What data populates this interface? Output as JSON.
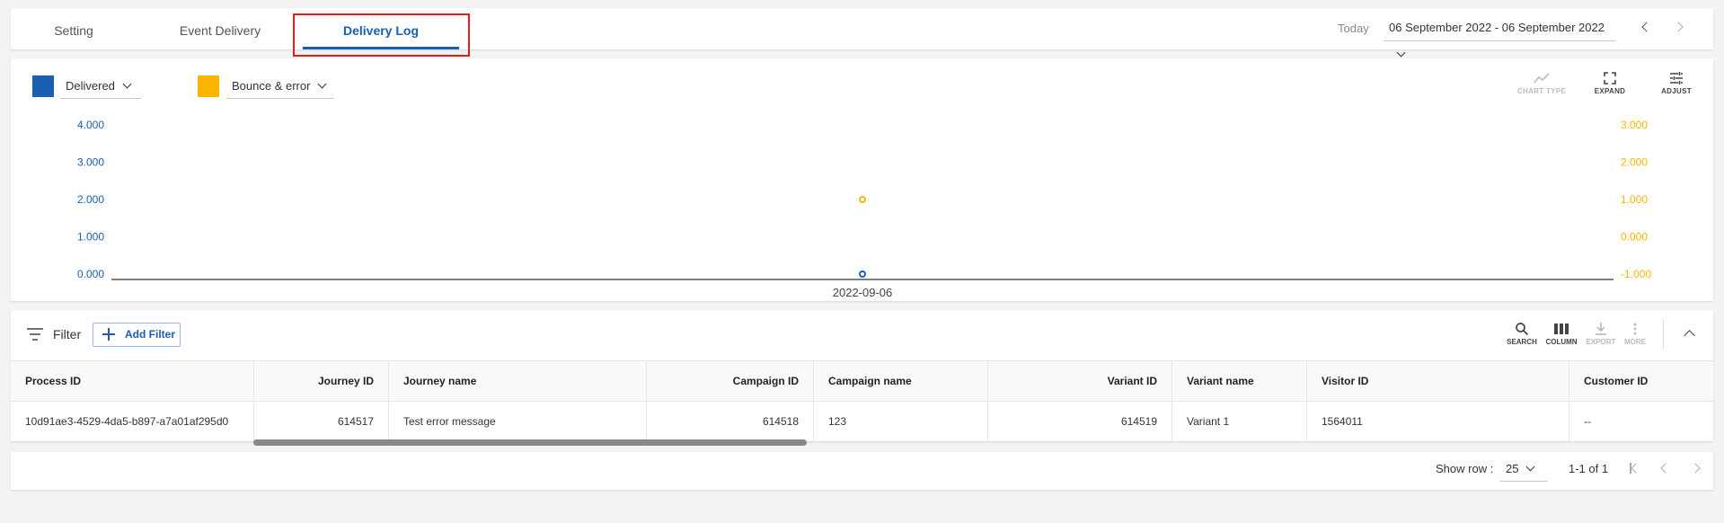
{
  "tabs": [
    {
      "label": "Setting",
      "active": false
    },
    {
      "label": "Event Delivery",
      "active": false
    },
    {
      "label": "Delivery Log",
      "active": true
    }
  ],
  "header": {
    "today_label": "Today",
    "date_range": "06 September 2022 - 06 September 2022"
  },
  "legend": [
    {
      "label": "Delivered",
      "color": "#1a5fb4"
    },
    {
      "label": "Bounce & error",
      "color": "#f9b600"
    }
  ],
  "chart_tools": [
    {
      "label": "CHART TYPE",
      "icon": "line-chart-icon",
      "enabled": false
    },
    {
      "label": "EXPAND",
      "icon": "expand-icon",
      "enabled": true
    },
    {
      "label": "ADJUST",
      "icon": "tune-icon",
      "enabled": true
    }
  ],
  "chart_data": {
    "type": "scatter",
    "x": [
      "2022-09-06"
    ],
    "series": [
      {
        "name": "Delivered",
        "axis": "left",
        "color": "#1a5fb4",
        "values": [
          0
        ]
      },
      {
        "name": "Bounce & error",
        "axis": "right",
        "color": "#f9b600",
        "values": [
          1
        ]
      }
    ],
    "left_axis": {
      "ticks": [
        "0.000",
        "1.000",
        "2.000",
        "3.000",
        "4.000"
      ],
      "range": [
        0,
        4
      ]
    },
    "right_axis": {
      "ticks": [
        "-1.000",
        "0.000",
        "1.000",
        "2.000",
        "3.000"
      ],
      "range": [
        -1,
        3
      ]
    },
    "grid": false
  },
  "filter": {
    "label": "Filter",
    "add_label": "Add Filter"
  },
  "table_tools": [
    {
      "label": "SEARCH",
      "icon": "search-icon",
      "enabled": true
    },
    {
      "label": "COLUMN",
      "icon": "column-icon",
      "enabled": true
    },
    {
      "label": "EXPORT",
      "icon": "download-icon",
      "enabled": false
    },
    {
      "label": "MORE",
      "icon": "more-vert-icon",
      "enabled": false
    }
  ],
  "table": {
    "columns": [
      "Process ID",
      "Journey ID",
      "Journey name",
      "Campaign ID",
      "Campaign name",
      "Variant ID",
      "Variant name",
      "Visitor ID",
      "Customer ID"
    ],
    "rows": [
      [
        "10d91ae3-4529-4da5-b897-a7a01af295d0",
        "614517",
        "Test error message",
        "614518",
        "123",
        "614519",
        "Variant 1",
        "1564011",
        "--"
      ]
    ]
  },
  "pagination": {
    "show_row_label": "Show row :",
    "rows_per_page": "25",
    "page_info": "1-1 of 1"
  }
}
